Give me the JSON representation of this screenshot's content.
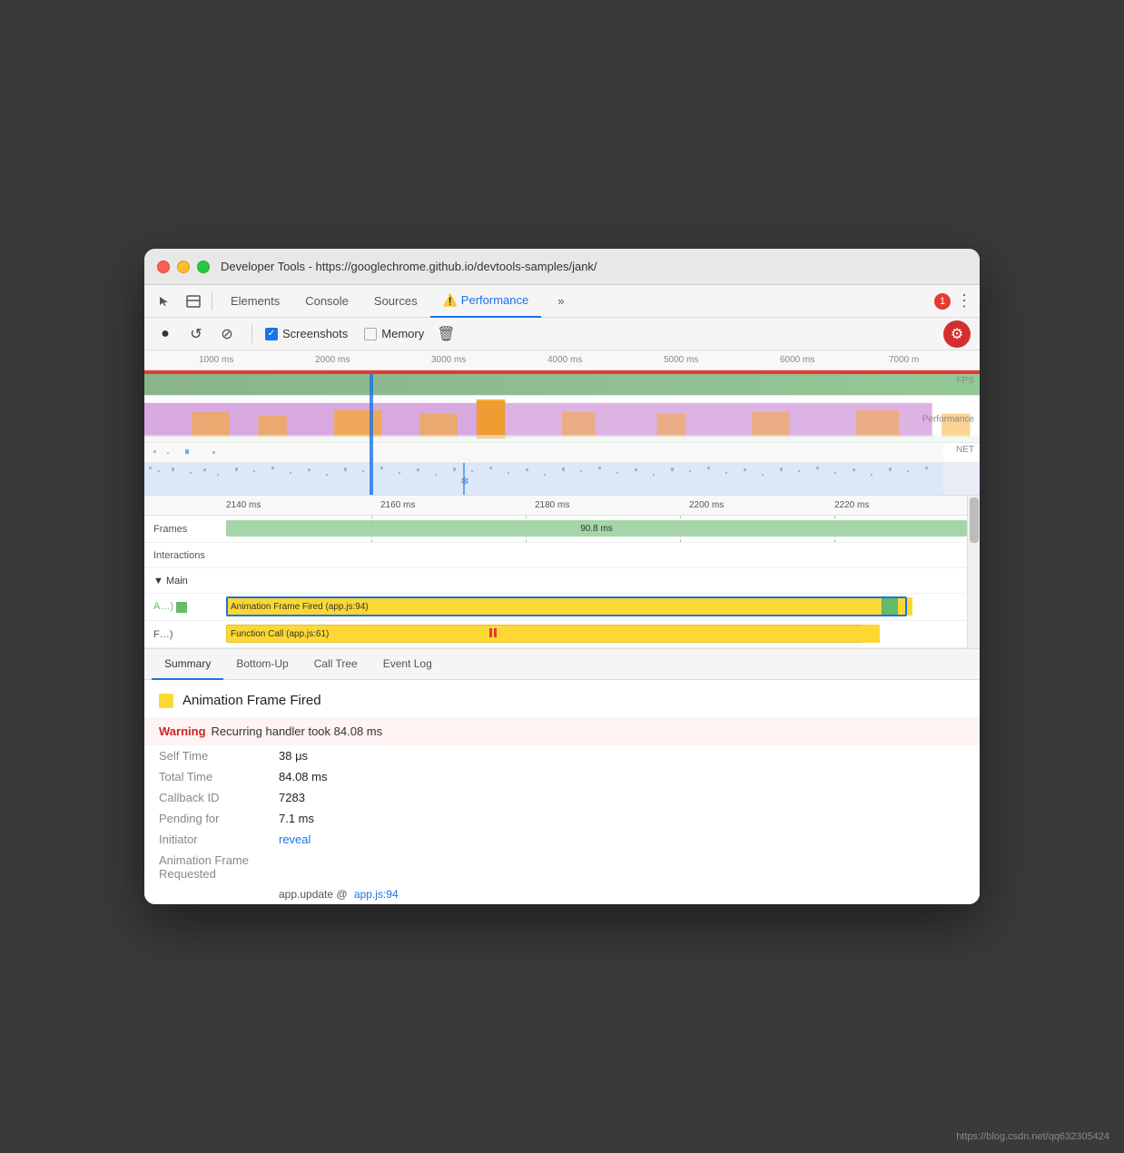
{
  "window": {
    "title": "Developer Tools - https://googlechrome.github.io/devtools-samples/jank/"
  },
  "tabs": [
    {
      "label": "Elements",
      "active": false
    },
    {
      "label": "Console",
      "active": false
    },
    {
      "label": "Sources",
      "active": false
    },
    {
      "label": "Performance",
      "active": true
    },
    {
      "label": "»",
      "active": false
    }
  ],
  "errors": {
    "count": "1"
  },
  "perf_toolbar": {
    "record_label": "●",
    "reload_label": "↺",
    "clear_label": "⊘",
    "screenshots_label": "Screenshots",
    "memory_label": "Memory",
    "trash_label": "🗑"
  },
  "ruler": {
    "ticks": [
      "1000 ms",
      "2000 ms",
      "3000 ms",
      "4000 ms",
      "5000 ms",
      "6000 ms",
      "7000 m"
    ]
  },
  "time_ruler": {
    "ticks": [
      "2140 ms",
      "2160 ms",
      "2180 ms",
      "2200 ms",
      "2220 ms"
    ]
  },
  "tracks": {
    "frames_label": "Frames",
    "frames_block": "90.8 ms",
    "interactions_label": "Interactions",
    "main_label": "▼ Main"
  },
  "call_blocks": [
    {
      "label": "Animation Frame Fired (app.js:94)",
      "type": "anim"
    },
    {
      "label": "Function Call (app.js:61)",
      "type": "func"
    }
  ],
  "bottom_tabs": [
    "Summary",
    "Bottom-Up",
    "Call Tree",
    "Event Log"
  ],
  "summary": {
    "title": "Animation Frame Fired",
    "color": "#fdd835",
    "warning_label": "Warning",
    "warning_text": "Recurring handler took 84.08 ms",
    "rows": [
      {
        "key": "Self Time",
        "val": "38 μs"
      },
      {
        "key": "Total Time",
        "val": "84.08 ms"
      },
      {
        "key": "Callback ID",
        "val": "7283"
      },
      {
        "key": "Pending for",
        "val": "7.1 ms"
      },
      {
        "key": "Initiator",
        "val": "reveal",
        "link": true
      },
      {
        "key": "Animation Frame Requested",
        "val": ""
      }
    ],
    "source_prefix": "app.update @",
    "source_link": "app.js:94"
  },
  "watermark": "https://blog.csdn.net/qq632305424"
}
